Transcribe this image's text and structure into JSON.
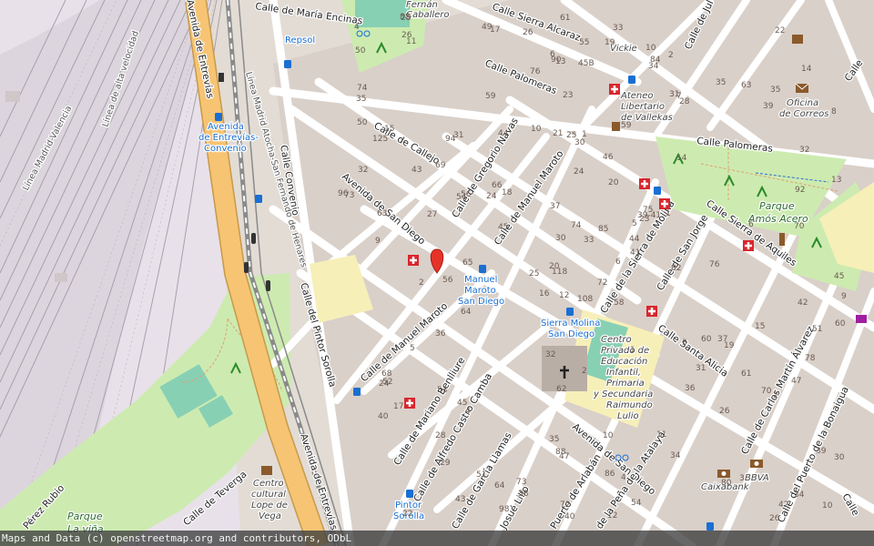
{
  "footer": {
    "attribution": "Maps and Data (c) openstreetmap.org and contributors, ODbL"
  },
  "colors": {
    "background": "#f2efe9",
    "block": "#e0dad2",
    "road": "#ffffff",
    "primary": "#f7c474",
    "park": "#cdebb0",
    "pitch": "#88d0b4",
    "school": "#f7efb8",
    "rail": "#9a9a9a",
    "marker": "#e6332a"
  },
  "streets": {
    "maria_encinas": "Calle de María Encinas",
    "sierra_alcaraz": "Calle Sierra Alcaraz",
    "palomeras": "Calle Palomeras",
    "palomeras_2": "Calle Palomeras",
    "callejo": "Calle de Callejo",
    "gregorio_navas": "Calle de Gregorio Navas",
    "manuel_maroto": "Calle de Manuel Maroto",
    "manuel_maroto_2": "Calle de Manuel Maroto",
    "avenida_san_diego": "Avenida de San Diego",
    "avenida_san_diego_2": "Avenida de San Diego",
    "convenio": "Calle Convenio",
    "pintor_sorolla": "Calle del Pintor Sorolla",
    "avenida_entrevias": "Avenida de Entrevías",
    "avenida_entrevias_2": "Avenida de Entrevías",
    "sierra_molina": "Calle de la Sierra de Molina",
    "san_jorge": "Calle de San Jorge",
    "sierra_aquiles": "Calle Sierra de Aquiles",
    "santa_alicia": "Calle Santa Alicia",
    "mariano_benlliure": "Calle de Mariano Benlliure",
    "alfredo_castro_camba": "Calle de Alfredo Castro Camba",
    "garcia_llamas": "Calle de García Llamas",
    "josue_lillo": "Josué Lillo",
    "puerto_arlaban": "Puerto de Arlabán",
    "pena_atalaya": "de la Peña de la Atalaya",
    "carlos_martin_alvarez": "Calle de Carlos Martín Álvarez",
    "puerto_bonaigua": "Calle del Puerto de la Bonaigua",
    "teverga": "Calle de Teverga",
    "perez_rubio": "Pérez Rubio",
    "calle_right": "Calle",
    "calle_jul": "Calle de Jul",
    "calle_se": "Calle"
  },
  "rail_labels": {
    "madrid_valencia": "Línea Madrid-Valencia",
    "alta_velocidad": "Línea de alta velocidad",
    "atocha_san_fernando": "Línea Madrid Atocha-San Fernando de Henares"
  },
  "pois": {
    "repsol": "Repsol",
    "fernan_caballero_1": "Fernán",
    "fernan_caballero_2": "Caballero",
    "vickie": "Vickie",
    "ateneo_1": "Ateneo",
    "ateneo_2": "Libertario",
    "ateneo_3": "de Vallekas",
    "correos_1": "Oficina",
    "correos_2": "de Correos",
    "parque_amos_1": "Parque",
    "parque_amos_2": "Amós Acero",
    "centro_privado_1": "Centro",
    "centro_privado_2": "Privado de",
    "centro_privado_3": "Educación",
    "centro_privado_4": "Infantil,",
    "centro_privado_5": "Primaria",
    "centro_privado_6": "y Secundaria",
    "centro_privado_7": "Raimundo",
    "centro_privado_8": "Lulio",
    "centro_cultural_1": "Centro",
    "centro_cultural_2": "cultural",
    "centro_cultural_3": "Lope de",
    "centro_cultural_4": "Vega",
    "caixabank": "Caixabank",
    "bbva": "BBVA",
    "parque_vina_1": "Parque",
    "parque_vina_2": "La viña"
  },
  "stops": {
    "entrevias_1": "Avenida",
    "entrevias_2": "de Entrevías-",
    "entrevias_3": "Convenio",
    "maroto_1": "Manuel",
    "maroto_2": "Maroto",
    "maroto_3": "San Diego",
    "molina_1": "Sierra Molina",
    "molina_2": "San Diego",
    "sorolla_1": "Pintor",
    "sorolla_2": "Sorolla"
  },
  "house_numbers": [
    "108",
    "125",
    "118",
    "5",
    "4",
    "2",
    "1",
    "7",
    "6",
    "11",
    "10",
    "9",
    "8",
    "16",
    "14",
    "22",
    "21",
    "20",
    "17",
    "18",
    "29",
    "25",
    "23",
    "19",
    "15",
    "13",
    "3",
    "13",
    "20",
    "35",
    "30",
    "31",
    "35",
    "45",
    "42",
    "39",
    "37",
    "33",
    "24",
    "27",
    "36",
    "43",
    "44",
    "47",
    "41",
    "40",
    "32",
    "31",
    "34",
    "28",
    "26",
    "4",
    "10",
    "35",
    "55",
    "65",
    "73",
    "69",
    "63",
    "88",
    "84",
    "76",
    "74",
    "62",
    "64",
    "60",
    "54",
    "50",
    "43",
    "37",
    "86",
    "85",
    "82",
    "78",
    "72",
    "70",
    "2",
    "3",
    "12",
    "11",
    "6",
    "9",
    "1",
    "26",
    "33",
    "47",
    "40",
    "31",
    "28",
    "2",
    "49",
    "45",
    "5",
    "53",
    "51",
    "39-41",
    "39",
    "45",
    "42",
    "35",
    "30",
    "25",
    "17",
    "12",
    "14",
    "10",
    "26",
    "24",
    "22",
    "46",
    "44",
    "76",
    "36",
    "34",
    "38",
    "6",
    "50",
    "52",
    "54",
    "56",
    "59",
    "51",
    "61",
    "64",
    "68",
    "60",
    "66",
    "58",
    "63",
    "70",
    "72",
    "75",
    "74",
    "73",
    "80",
    "88",
    "90",
    "92",
    "94",
    "96",
    "98",
    "15",
    "19",
    "23",
    "24",
    "56",
    "59",
    "1",
    "45B",
    "61",
    "34",
    "32",
    "32",
    "30",
    "28",
    "26",
    "2",
    "4",
    "10"
  ]
}
